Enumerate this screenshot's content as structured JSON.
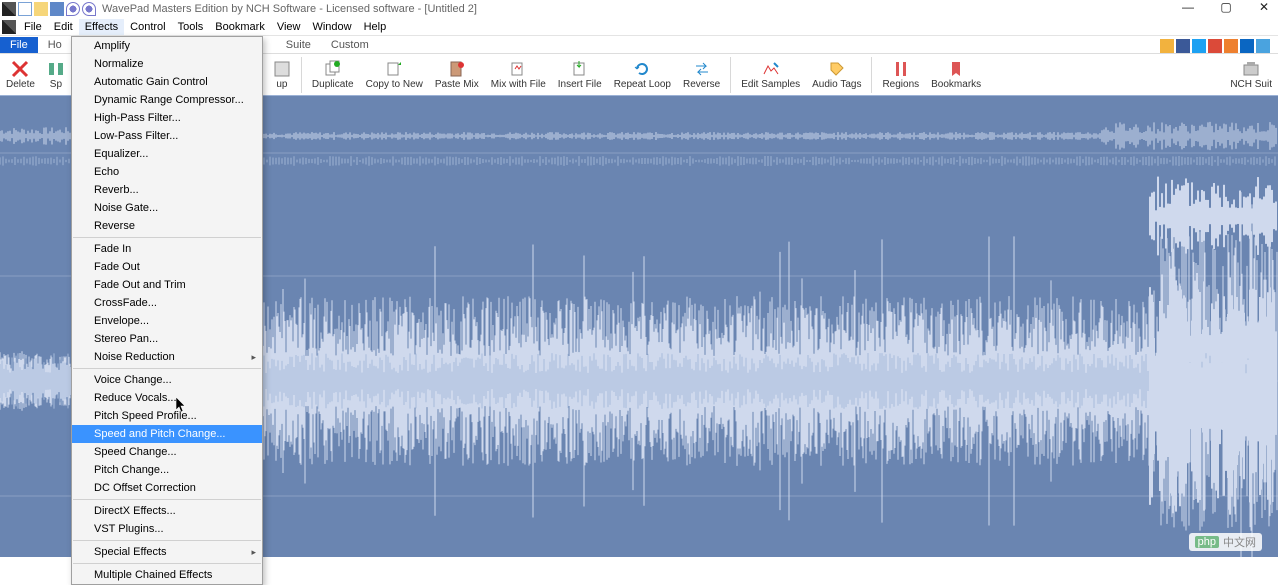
{
  "window": {
    "title": "WavePad Masters Edition by NCH Software - Licensed software - [Untitled 2]",
    "controls": {
      "minimize": "—",
      "maximize": "▢",
      "close": "✕"
    }
  },
  "quick_access": [
    {
      "name": "new",
      "color": "#fff",
      "border": "#7aa2d6"
    },
    {
      "name": "open",
      "color": "#f6d67a"
    },
    {
      "name": "save",
      "color": "#5f88c8"
    },
    {
      "name": "undo",
      "color": "#7777cc"
    },
    {
      "name": "redo",
      "color": "#7777cc"
    }
  ],
  "menubar": [
    "File",
    "Edit",
    "Effects",
    "Control",
    "Tools",
    "Bookmark",
    "View",
    "Window",
    "Help"
  ],
  "menubar_open_index": 2,
  "ribbon": {
    "tabs": [
      "File",
      "Home",
      "Suite",
      "Custom"
    ],
    "active_tab_index": 0,
    "partial_second_tab_text": "Ho",
    "social": [
      {
        "name": "thumbs-up",
        "color": "#f2b23e"
      },
      {
        "name": "facebook",
        "color": "#3b5998"
      },
      {
        "name": "twitter",
        "color": "#1da1f2"
      },
      {
        "name": "google-plus",
        "color": "#db4a39"
      },
      {
        "name": "rss",
        "color": "#ee802f"
      },
      {
        "name": "linkedin",
        "color": "#0a66c2"
      },
      {
        "name": "share",
        "color": "#4aa3df"
      }
    ]
  },
  "toolbar": {
    "left": [
      {
        "name": "delete",
        "label": "Delete",
        "icon": "x-red"
      },
      {
        "name": "split",
        "label": "Sp",
        "icon": "split"
      }
    ],
    "right": [
      {
        "name": "duplicate",
        "label": "Duplicate",
        "icon": "dup"
      },
      {
        "name": "copy-to-new",
        "label": "Copy to New",
        "icon": "copynew"
      },
      {
        "name": "paste-mix",
        "label": "Paste Mix",
        "icon": "pastemix"
      },
      {
        "name": "mix-with-file",
        "label": "Mix with File",
        "icon": "mixfile"
      },
      {
        "name": "insert-file",
        "label": "Insert File",
        "icon": "insertfile"
      },
      {
        "name": "repeat-loop",
        "label": "Repeat Loop",
        "icon": "loop"
      },
      {
        "name": "reverse",
        "label": "Reverse",
        "icon": "reverse"
      },
      {
        "name": "edit-samples",
        "label": "Edit Samples",
        "icon": "samples"
      },
      {
        "name": "audio-tags",
        "label": "Audio Tags",
        "icon": "tags"
      },
      {
        "name": "regions",
        "label": "Regions",
        "icon": "regions"
      },
      {
        "name": "bookmarks",
        "label": "Bookmarks",
        "icon": "bookmarks"
      }
    ],
    "far_right": {
      "name": "nch-suite",
      "label": "NCH Suit",
      "icon": "suite"
    },
    "truncated_visible_label": "up"
  },
  "effects_menu": {
    "groups": [
      [
        "Amplify",
        "Normalize",
        "Automatic Gain Control",
        "Dynamic Range Compressor...",
        "High-Pass Filter...",
        "Low-Pass Filter...",
        "Equalizer...",
        "Echo",
        "Reverb...",
        "Noise Gate...",
        "Reverse"
      ],
      [
        "Fade In",
        "Fade Out",
        "Fade Out and Trim",
        "CrossFade...",
        "Envelope...",
        "Stereo Pan...",
        "Noise Reduction"
      ],
      [
        "Voice Change...",
        "Reduce Vocals...",
        "Pitch Speed Profile...",
        "Speed and Pitch Change...",
        "Speed Change...",
        "Pitch Change...",
        "DC Offset Correction"
      ],
      [
        "DirectX Effects...",
        "VST Plugins..."
      ],
      [
        "Special Effects"
      ],
      [
        "Multiple Chained Effects"
      ]
    ],
    "submenu_items": [
      "Noise Reduction",
      "Special Effects"
    ],
    "highlighted": "Speed and Pitch Change..."
  },
  "watermark": {
    "text": "中文网",
    "prefix": "php"
  },
  "colors": {
    "wave_bg": "#6a85b1",
    "wave_light": "#cfd9ed",
    "wave_mid": "#a7bbdc",
    "highlight": "#3a93ff"
  }
}
